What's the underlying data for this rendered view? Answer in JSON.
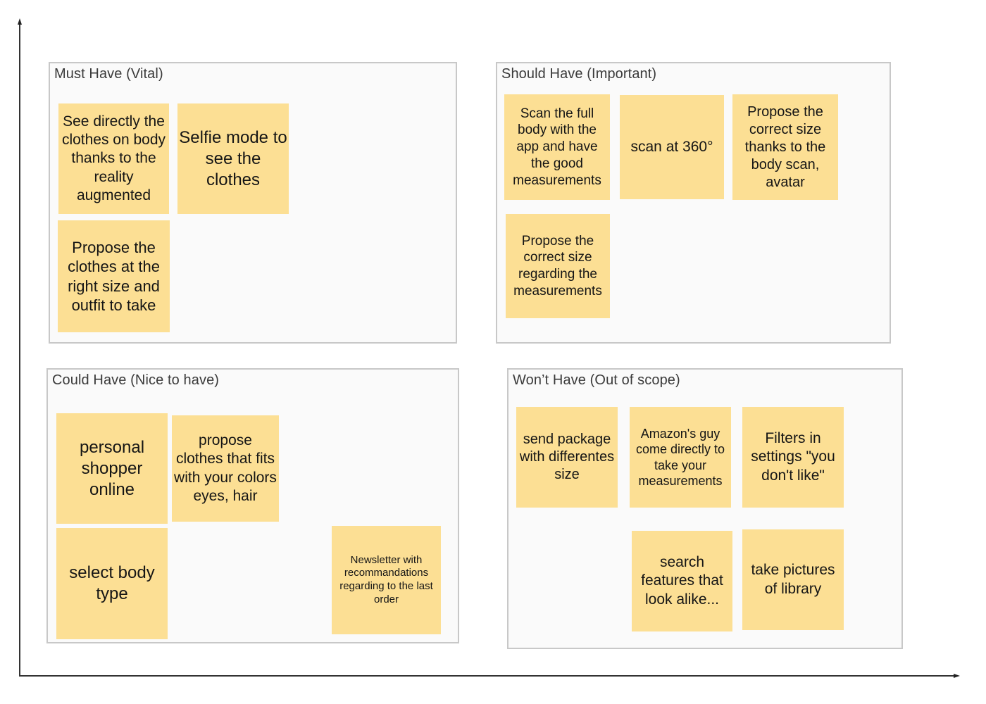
{
  "board": {
    "axes": {
      "vertical_arrow": "up",
      "horizontal_arrow": "right"
    },
    "sticky_color": "#fcdf94",
    "frames": {
      "must": {
        "title": "Must Have (Vital)",
        "notes": [
          "See directly the clothes on body thanks to the reality augmented",
          "Selfie mode to see the clothes",
          "Propose the clothes at the right size and outfit to take"
        ]
      },
      "should": {
        "title": "Should Have (Important)",
        "notes": [
          "Scan the full body with the app and have the good measurements",
          "scan at 360°",
          "Propose the correct size thanks to the body scan, avatar",
          "Propose the correct size regarding the measurements"
        ]
      },
      "could": {
        "title": "Could Have (Nice to have)",
        "notes": [
          "personal shopper online",
          "propose clothes that fits with your colors eyes, hair",
          "select body type",
          "Newsletter with recommandations regarding to the last order"
        ]
      },
      "wont": {
        "title": "Won’t Have (Out of scope)",
        "notes": [
          "send package with differentes size",
          "Amazon's guy come directly to take your measurements",
          "Filters in settings \"you don't like\"",
          "search features that look alike...",
          "take pictures of library"
        ]
      }
    }
  }
}
